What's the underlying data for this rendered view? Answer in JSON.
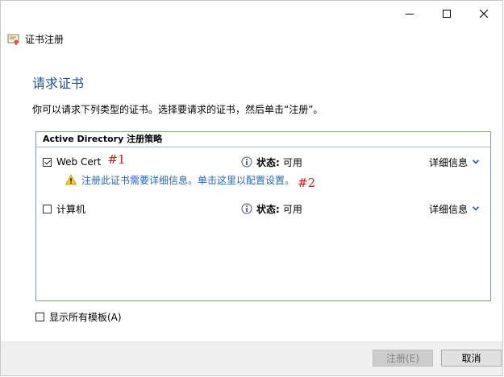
{
  "window": {
    "minimize_glyph": "minimize",
    "maximize_glyph": "maximize",
    "close_glyph": "close"
  },
  "app": {
    "title": "证书注册"
  },
  "page": {
    "heading": "请求证书",
    "instruction": "你可以请求下列类型的证书。选择要请求的证书，然后单击“注册”。"
  },
  "policy": {
    "header": "Active Directory 注册策略",
    "certificates": [
      {
        "name": "Web Cert",
        "checked": true,
        "annotation": "#1",
        "status_label": "状态:",
        "status_value": "可用",
        "details_label": "详细信息",
        "warning": "注册此证书需要详细信息。单击这里以配置设置。",
        "warning_annotation": "#2"
      },
      {
        "name": "计算机",
        "checked": false,
        "status_label": "状态:",
        "status_value": "可用",
        "details_label": "详细信息"
      }
    ]
  },
  "options": {
    "show_all_templates": "显示所有模板(A)",
    "show_all_checked": false
  },
  "footer": {
    "enroll_label": "注册(E)",
    "cancel_label": "取消"
  },
  "colors": {
    "heading": "#1e4f9e",
    "link": "#2468b5",
    "annotation": "#d31a1a",
    "border": "#7a96c4"
  }
}
